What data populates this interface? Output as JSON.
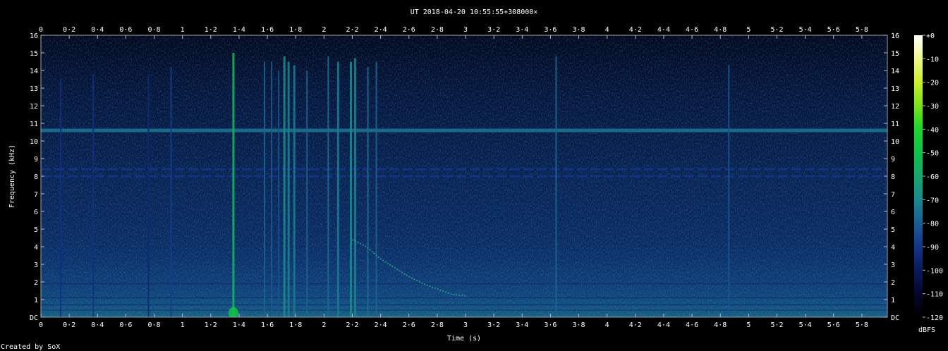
{
  "chart_data": {
    "type": "heatmap",
    "title": "UT 2018-04-20 10:55:55+308000×",
    "xlabel": "Time (s)",
    "ylabel": "Frequency (kHz)",
    "xlim": [
      0,
      5.98
    ],
    "ylim": [
      0,
      16
    ],
    "x_ticks": [
      "0",
      "0·2",
      "0·4",
      "0·6",
      "0·8",
      "1",
      "1·2",
      "1·4",
      "1·6",
      "1·8",
      "2",
      "2·2",
      "2·4",
      "2·6",
      "2·8",
      "3",
      "3·2",
      "3·4",
      "3·6",
      "3·8",
      "4",
      "4·2",
      "4·4",
      "4·6",
      "4·8",
      "5",
      "5·2",
      "5·4",
      "5·6",
      "5·8"
    ],
    "y_ticks": [
      "DC",
      "1",
      "2",
      "3",
      "4",
      "5",
      "6",
      "7",
      "8",
      "9",
      "10",
      "11",
      "12",
      "13",
      "14",
      "15",
      "16"
    ],
    "colorbar": {
      "label": "dBFS",
      "range": [
        -120,
        0
      ],
      "ticks": [
        "+0",
        "-10",
        "-20",
        "-30",
        "-40",
        "-50",
        "-60",
        "-70",
        "-80",
        "-90",
        "-100",
        "-110",
        "-120"
      ]
    },
    "background_level_dbfs": -105,
    "tones": [
      {
        "freq_khz": 10.6,
        "level_dbfs": -75,
        "style": "continuous"
      },
      {
        "freq_khz": 8.4,
        "level_dbfs": -90,
        "style": "dashed"
      },
      {
        "freq_khz": 8.0,
        "level_dbfs": -90,
        "style": "dashed"
      },
      {
        "freq_khz": 1.9,
        "level_dbfs": -98,
        "style": "faint"
      },
      {
        "freq_khz": 1.1,
        "level_dbfs": -98,
        "style": "faint"
      },
      {
        "freq_khz": 0.7,
        "level_dbfs": -98,
        "style": "faint"
      },
      {
        "freq_khz": 0.4,
        "level_dbfs": -95,
        "style": "faint"
      }
    ],
    "impulses": [
      {
        "t": 0.14,
        "top_khz": 13.5,
        "level_dbfs": -92
      },
      {
        "t": 0.37,
        "top_khz": 13.8,
        "level_dbfs": -92
      },
      {
        "t": 0.76,
        "top_khz": 13.8,
        "level_dbfs": -95
      },
      {
        "t": 0.92,
        "top_khz": 14.2,
        "level_dbfs": -88
      },
      {
        "t": 1.36,
        "top_khz": 15.0,
        "level_dbfs": -55
      },
      {
        "t": 1.58,
        "top_khz": 14.5,
        "level_dbfs": -78
      },
      {
        "t": 1.63,
        "top_khz": 14.5,
        "level_dbfs": -80
      },
      {
        "t": 1.68,
        "top_khz": 14.0,
        "level_dbfs": -82
      },
      {
        "t": 1.72,
        "top_khz": 14.8,
        "level_dbfs": -70
      },
      {
        "t": 1.75,
        "top_khz": 14.5,
        "level_dbfs": -72
      },
      {
        "t": 1.79,
        "top_khz": 14.3,
        "level_dbfs": -74
      },
      {
        "t": 1.88,
        "top_khz": 14.0,
        "level_dbfs": -78
      },
      {
        "t": 2.03,
        "top_khz": 14.8,
        "level_dbfs": -76
      },
      {
        "t": 2.1,
        "top_khz": 14.5,
        "level_dbfs": -74
      },
      {
        "t": 2.19,
        "top_khz": 14.5,
        "level_dbfs": -70
      },
      {
        "t": 2.22,
        "top_khz": 14.7,
        "level_dbfs": -72
      },
      {
        "t": 2.31,
        "top_khz": 14.2,
        "level_dbfs": -76
      },
      {
        "t": 2.37,
        "top_khz": 14.5,
        "level_dbfs": -78
      },
      {
        "t": 3.64,
        "top_khz": 14.8,
        "level_dbfs": -78
      },
      {
        "t": 4.86,
        "top_khz": 14.3,
        "level_dbfs": -82
      }
    ],
    "sweep": {
      "points": [
        [
          2.2,
          4.4
        ],
        [
          2.3,
          4.0
        ],
        [
          2.4,
          3.3
        ],
        [
          2.5,
          2.8
        ],
        [
          2.6,
          2.3
        ],
        [
          2.7,
          1.9
        ],
        [
          2.8,
          1.6
        ],
        [
          2.9,
          1.3
        ],
        [
          3.0,
          1.2
        ]
      ],
      "level_dbfs": -92
    },
    "grid": false
  },
  "footer": {
    "credit": "Created by SoX"
  }
}
